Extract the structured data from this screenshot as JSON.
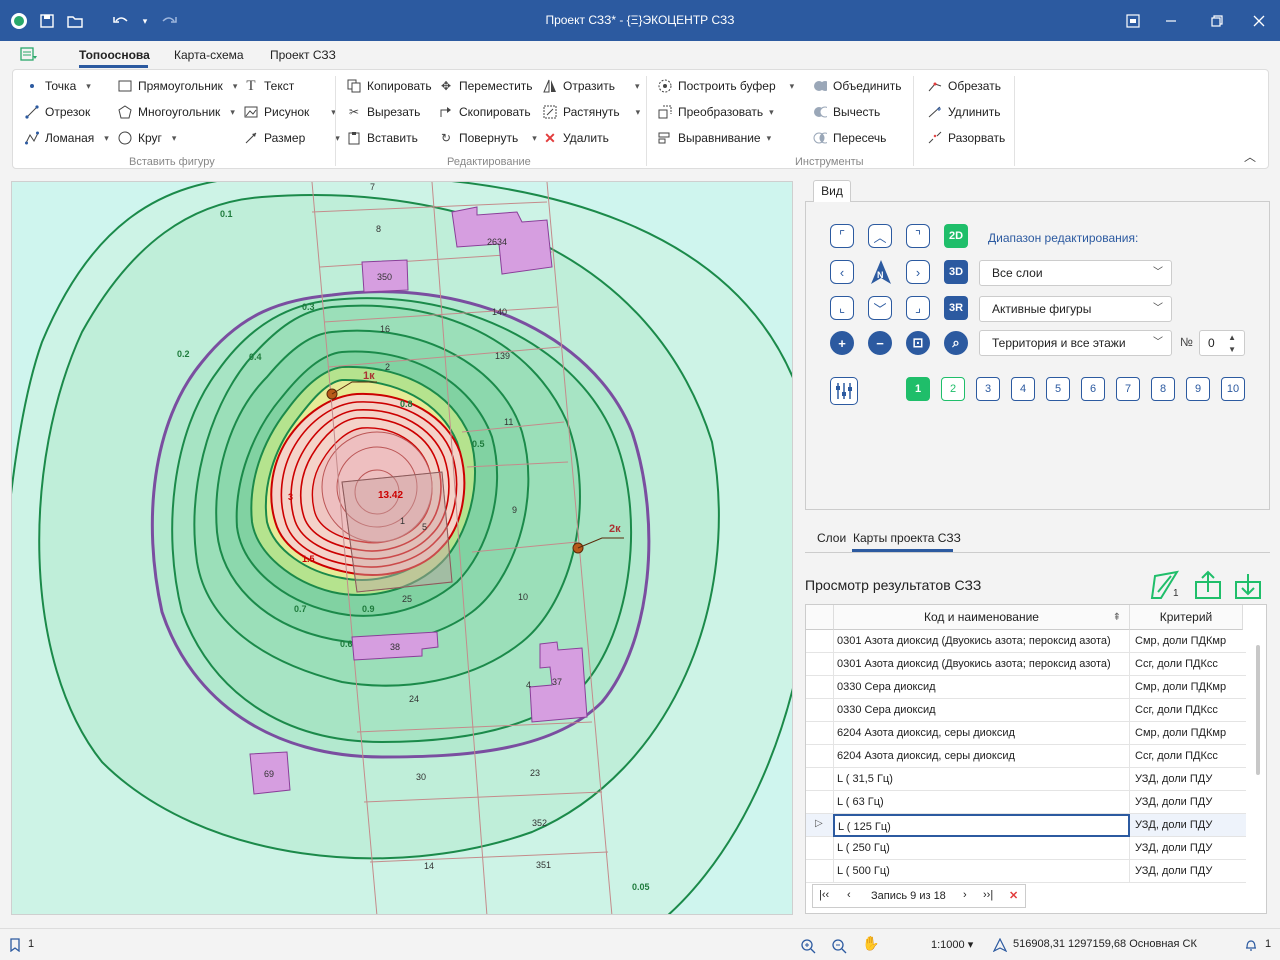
{
  "titlebar": {
    "title": "Проект СЗЗ* - {Ξ}ЭКОЦЕНТР СЗЗ"
  },
  "menu": {
    "tabs": [
      "Топооснова",
      "Карта-схема",
      "Проект СЗЗ"
    ],
    "active": 0
  },
  "ribbon": {
    "groups": [
      "Вставить фигуру",
      "Редактирование",
      "Инструменты"
    ],
    "insert": [
      "Точка",
      "Отрезок",
      "Ломаная",
      "Прямоугольник",
      "Многоугольник",
      "Круг",
      "Текст",
      "Рисунок",
      "Размер"
    ],
    "edit": [
      "Копировать",
      "Вырезать",
      "Вставить",
      "Переместить",
      "Скопировать",
      "Повернуть",
      "Отразить",
      "Растянуть",
      "Удалить"
    ],
    "tools": [
      "Построить буфер",
      "Преобразовать",
      "Выравнивание",
      "Объединить",
      "Вычесть",
      "Пересечь",
      "Обрезать",
      "Удлинить",
      "Разорвать"
    ]
  },
  "view": {
    "tab": "Вид",
    "modes": [
      "2D",
      "3D",
      "3R"
    ],
    "north": "N",
    "range_label": "Диапазон редактирования:",
    "layers_combo": "Все слои",
    "figures_combo": "Активные фигуры",
    "territory_combo": "Территория и все этажи",
    "number_label": "№",
    "number_value": "0",
    "floors": [
      "1",
      "2",
      "3",
      "4",
      "5",
      "6",
      "7",
      "8",
      "9",
      "10"
    ]
  },
  "lower_tabs": [
    "Слои",
    "Карты проекта СЗЗ"
  ],
  "results": {
    "title": "Просмотр результатов СЗЗ",
    "badge": "1",
    "columns": [
      "Код и наименование",
      "Критерий"
    ],
    "rows": [
      {
        "name": "0301 Азота диоксид (Двуокись азота; пероксид азота)",
        "crit": "Смр, доли ПДКмр"
      },
      {
        "name": "0301 Азота диоксид (Двуокись азота; пероксид азота)",
        "crit": "Ссг, доли ПДКсс"
      },
      {
        "name": "0330 Сера диоксид",
        "crit": "Смр, доли ПДКмр"
      },
      {
        "name": "0330 Сера диоксид",
        "crit": "Ссг, доли ПДКсс"
      },
      {
        "name": "6204 Азота диоксид, серы диоксид",
        "crit": "Смр, доли ПДКмр"
      },
      {
        "name": "6204 Азота диоксид, серы диоксид",
        "crit": "Ссг, доли ПДКсс"
      },
      {
        "name": "L (  31,5 Гц)",
        "crit": "УЗД, доли ПДУ"
      },
      {
        "name": "L (  63 Гц)",
        "crit": "УЗД, доли ПДУ"
      },
      {
        "name": "L ( 125 Гц)",
        "crit": "УЗД, доли ПДУ"
      },
      {
        "name": "L ( 250 Гц)",
        "crit": "УЗД, доли ПДУ"
      },
      {
        "name": "L ( 500 Гц)",
        "crit": "УЗД, доли ПДУ"
      }
    ],
    "current_row": 8,
    "pager": "Запись 9 из 18"
  },
  "map": {
    "center_value": "13.42",
    "point1": "1к",
    "point2": "2к",
    "contour_labels": [
      "0.1",
      "0.2",
      "0.3",
      "0.4",
      "0.5",
      "0.6",
      "0.7",
      "0.8",
      "0.9",
      "0.05",
      "3",
      "1.5"
    ],
    "parcels": [
      "7",
      "8",
      "2634",
      "350",
      "16",
      "140",
      "139",
      "2",
      "11",
      "9",
      "1",
      "10",
      "25",
      "38",
      "4",
      "37",
      "24",
      "69",
      "30",
      "23",
      "352",
      "14",
      "351",
      "5"
    ]
  },
  "status": {
    "page": "1",
    "scale": "1:1000",
    "coords": "516908,31 1297159,68 Основная СК",
    "notifications": "1"
  }
}
